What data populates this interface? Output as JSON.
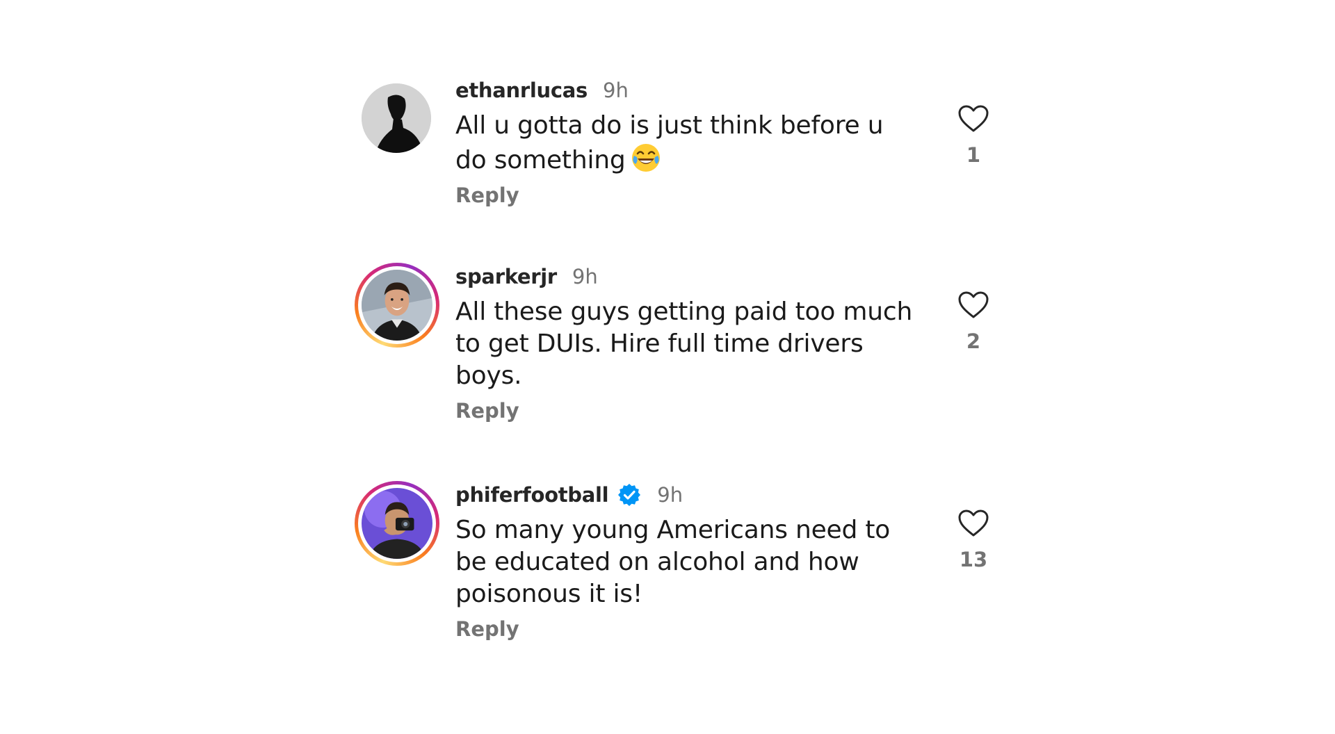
{
  "comments": [
    {
      "username": "ethanrlucas",
      "verified": false,
      "time": "9h",
      "text": "All u gotta do is just think before u do something",
      "emoji": "face-with-tears-of-joy",
      "reply_label": "Reply",
      "likes": "1",
      "avatar_ring": false
    },
    {
      "username": "sparkerjr",
      "verified": false,
      "time": "9h",
      "text": "All these guys getting paid too much to get DUIs. Hire full time drivers boys.",
      "reply_label": "Reply",
      "likes": "2",
      "avatar_ring": true
    },
    {
      "username": "phiferfootball",
      "verified": true,
      "time": "9h",
      "text": "So many young Americans need to be educated on alcohol and how poisonous it is!",
      "reply_label": "Reply",
      "likes": "13",
      "avatar_ring": true
    }
  ],
  "colors": {
    "username": "#262626",
    "muted": "#737373",
    "verified_blue": "#0095f6",
    "ring_start": "#feda75",
    "ring_mid": "#d62976",
    "ring_end": "#962fbf"
  }
}
